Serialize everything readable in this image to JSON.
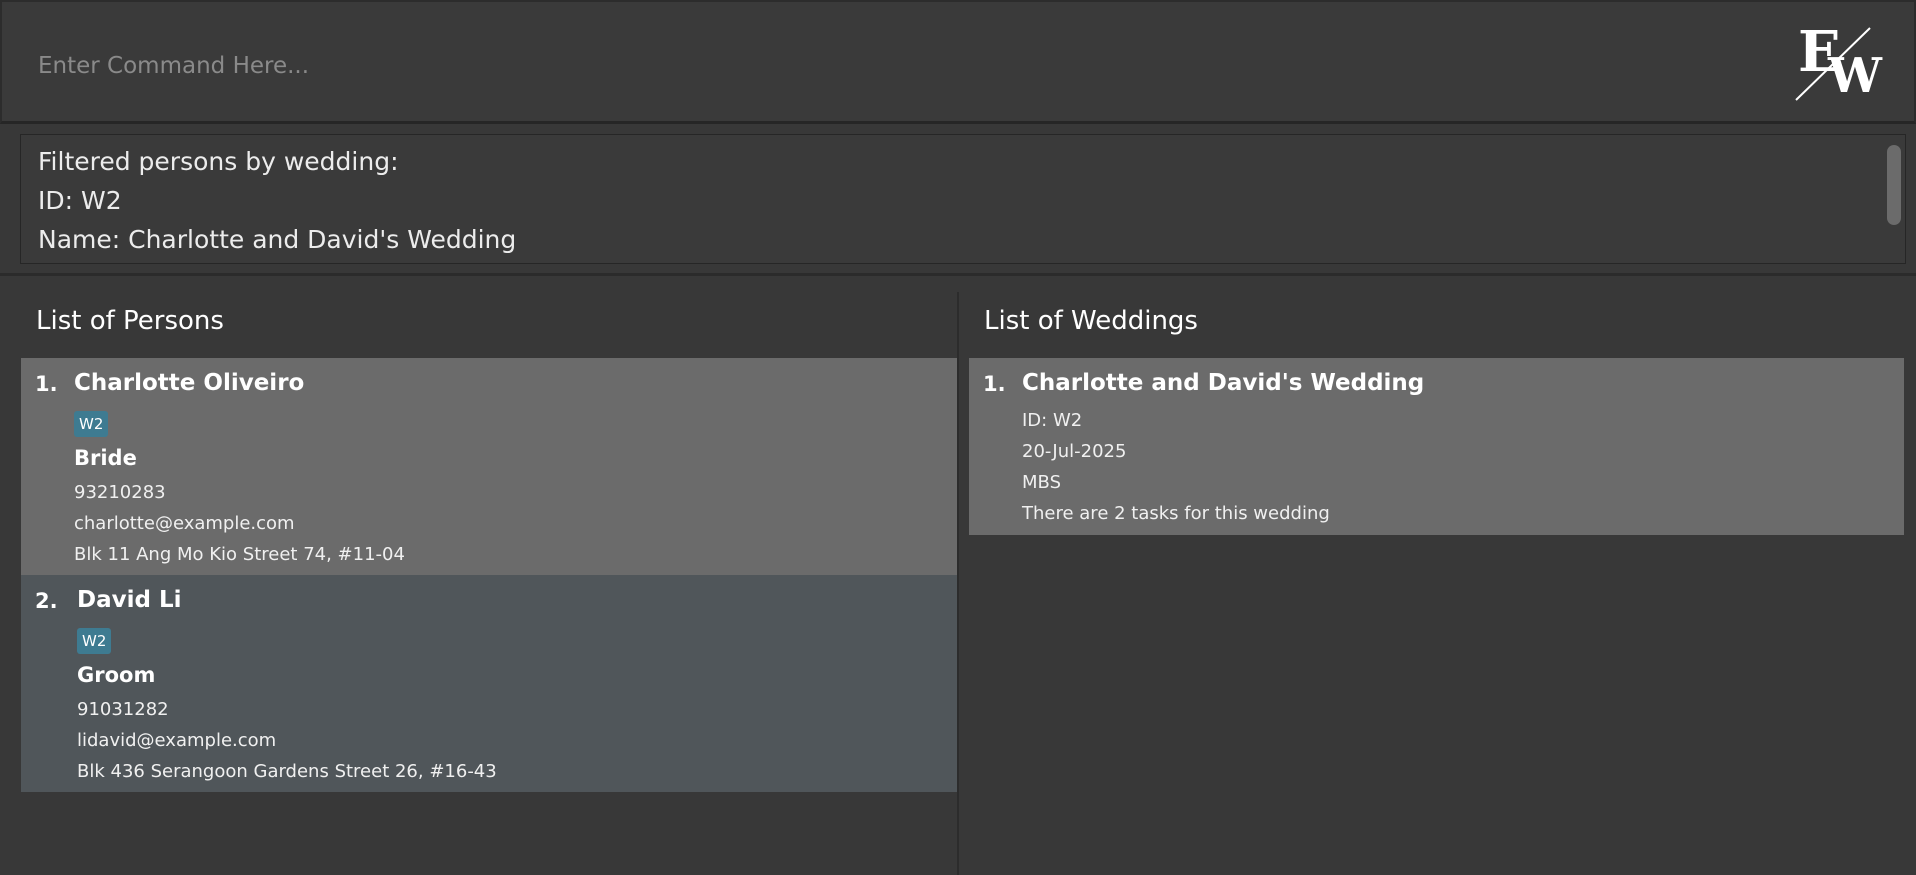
{
  "command": {
    "placeholder": "Enter Command Here..."
  },
  "logo": {
    "letters": "EW"
  },
  "result": {
    "lines": [
      "Filtered persons by wedding:",
      "ID: W2",
      "Name: Charlotte and David's Wedding"
    ]
  },
  "persons_panel": {
    "title": "List of Persons",
    "items": [
      {
        "index": "1.",
        "name": "Charlotte Oliveiro",
        "tag": "W2",
        "role": "Bride",
        "phone": "93210283",
        "email": "charlotte@example.com",
        "address": "Blk 11 Ang Mo Kio Street 74, #11-04"
      },
      {
        "index": "2.",
        "name": "David Li",
        "tag": "W2",
        "role": "Groom",
        "phone": "91031282",
        "email": "lidavid@example.com",
        "address": "Blk 436 Serangoon Gardens Street 26, #16-43"
      }
    ]
  },
  "weddings_panel": {
    "title": "List of Weddings",
    "items": [
      {
        "index": "1.",
        "name": "Charlotte and David's Wedding",
        "id": "ID: W2",
        "date": "20-Jul-2025",
        "venue": "MBS",
        "tasks": "There are 2 tasks for this wedding"
      }
    ]
  },
  "colors": {
    "background": "#383838",
    "selected_card": "#6b6b6b",
    "alt_card": "#50565a",
    "tag": "#3e7b91"
  }
}
